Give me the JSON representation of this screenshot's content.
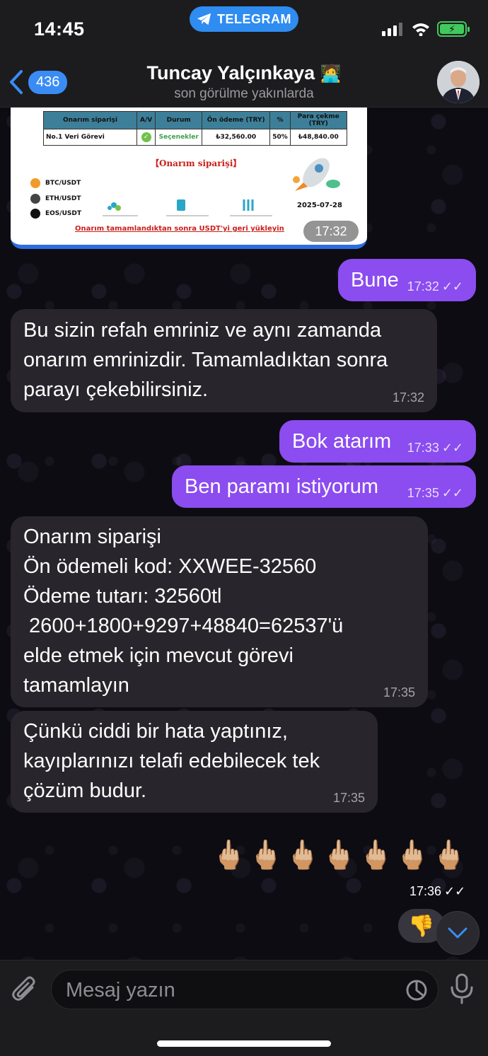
{
  "status": {
    "time": "14:45",
    "app_pill": "TELEGRAM",
    "battery_icon": "battery-charging-icon"
  },
  "header": {
    "back_count": "436",
    "name": "Tuncay Yalçınkaya",
    "name_emoji": "🧑‍💻",
    "subtitle": "son görülme yakınlarda"
  },
  "image_message": {
    "table_headers": [
      "Onarım siparişi",
      "A/V",
      "Durum",
      "Ön ödeme (TRY)",
      "%",
      "Para çekme (TRY)"
    ],
    "table_row": [
      "No.1 Veri Görevi",
      "✓",
      "Seçenekler",
      "₺32,560.00",
      "50%",
      "₺48,840.00"
    ],
    "heading": "【Onarım siparişi】",
    "coins": [
      "BTC/USDT",
      "ETH/USDT",
      "EOS/USDT"
    ],
    "date": "2025-07-28",
    "footer": "Onarım tamamlandıktan sonra USDT'yi geri yükleyin",
    "time": "17:32"
  },
  "messages": [
    {
      "dir": "out",
      "text": "Bune",
      "time": "17:32"
    },
    {
      "dir": "in",
      "text": "Bu sizin refah emriniz ve aynı zamanda onarım emrinizdir. Tamamladıktan sonra parayı çekebilirsiniz.",
      "time": "17:32"
    },
    {
      "dir": "out",
      "text": "Bok atarım",
      "time": "17:33"
    },
    {
      "dir": "out",
      "text": "Ben paramı istiyorum",
      "time": "17:35"
    },
    {
      "dir": "in",
      "lines": [
        "Onarım siparişi",
        "Ön ödemeli kod: XXWEE-32560",
        "Ödeme tutarı: 32560tl",
        " 2600+1800+9297+48840=62537'ü",
        "elde etmek için mevcut görevi",
        "tamamlayın"
      ],
      "time": "17:35"
    },
    {
      "dir": "in",
      "lines": [
        "Çünkü ciddi bir hata yaptınız,",
        "kayıplarınızı telafi edebilecek tek",
        "çözüm budur."
      ],
      "time": "17:35"
    }
  ],
  "emoji_message": {
    "emojis": "🖕🏼🖕🏼🖕🏼🖕🏼🖕🏼🖕🏼🖕🏼",
    "time": "17:36"
  },
  "reaction": "👎",
  "composer": {
    "placeholder": "Mesaj yazın"
  }
}
